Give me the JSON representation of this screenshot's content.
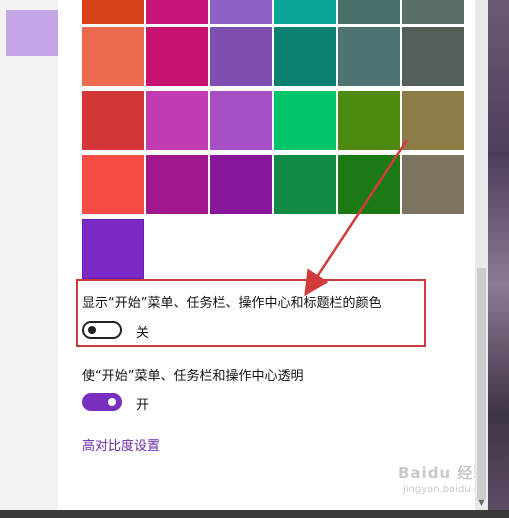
{
  "colors": {
    "accent": "#7a2fbf",
    "link": "#6b2aa3",
    "highlight_border": "#c93a3a"
  },
  "swatch_rows": [
    [
      "#d8401a",
      "#c8157a",
      "#8e62c4",
      "#0ba597",
      "#4a6e6a",
      "#5b6f68"
    ],
    [
      "#ec6a4e",
      "#c81271",
      "#7e4fae",
      "#0b8072",
      "#4e7371",
      "#525e56"
    ],
    [
      "#d43737",
      "#c13cb3",
      "#a74fc4",
      "#00c46a",
      "#4f8a10",
      "#8c7d48"
    ],
    [
      "#f44c45",
      "#a0178e",
      "#88179b",
      "#128a46",
      "#1c7a14",
      "#7c7260"
    ]
  ],
  "selected_swatch": "#7b2ac8",
  "settings": {
    "show_color": {
      "label": "显示“开始”菜单、任务栏、操作中心和标题栏的颜色",
      "toggle_on": false,
      "state": "关"
    },
    "transparency": {
      "label": "使“开始”菜单、任务栏和操作中心透明",
      "toggle_on": true,
      "state": "开"
    }
  },
  "contrast_link": "高对比度设置",
  "watermark": {
    "logo": "Baidu 经验",
    "url": "jingyan.baidu.com"
  }
}
